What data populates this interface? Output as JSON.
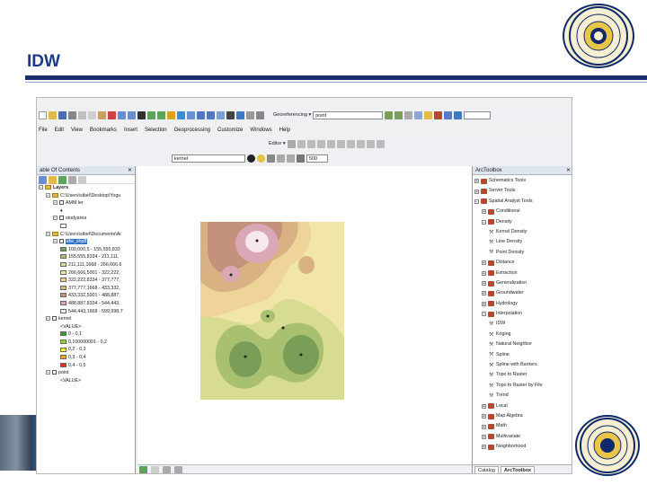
{
  "slide": {
    "title": "IDW"
  },
  "arcmap": {
    "menu": [
      "File",
      "Edit",
      "View",
      "Bookmarks",
      "Insert",
      "Selection",
      "Geoprocessing",
      "Customize",
      "Windows",
      "Help"
    ],
    "georef_label": "Georeferencing ▾",
    "georef_layer": "point",
    "editor_label": "Editor ▾",
    "layer_combo": "kernel",
    "resolution_combo": "500"
  },
  "toc": {
    "title": "able Of Contents",
    "rows": [
      {
        "indent": 0,
        "text": "Layers",
        "kind": "folder",
        "bold": true
      },
      {
        "indent": 1,
        "text": "C:\\Users\\sibel\\Desktop\\Yogu",
        "kind": "folder"
      },
      {
        "indent": 2,
        "text": "AMM ler",
        "kind": "check"
      },
      {
        "indent": 3,
        "text": "♦",
        "kind": "plain"
      },
      {
        "indent": 2,
        "text": "studyarea",
        "kind": "check"
      },
      {
        "indent": 3,
        "text": "",
        "kind": "swatch",
        "color": "#ffffff"
      },
      {
        "indent": 1,
        "text": "C:\\Users\\sibel\\Documents\\Ar",
        "kind": "folder"
      },
      {
        "indent": 2,
        "text": "idw_shp8",
        "kind": "check",
        "selected": true
      },
      {
        "indent": 3,
        "text": "100,000,5 - 155,555,833",
        "kind": "swatch",
        "color": "#7a9d58"
      },
      {
        "indent": 3,
        "text": "155,555,8334 - 211,111,",
        "kind": "swatch",
        "color": "#a8c06f"
      },
      {
        "indent": 3,
        "text": "211,111,1668 - 266,666,6",
        "kind": "swatch",
        "color": "#d8dc93"
      },
      {
        "indent": 3,
        "text": "266,666,5001 - 322,222,",
        "kind": "swatch",
        "color": "#f1e5a8"
      },
      {
        "indent": 3,
        "text": "322,222,8334 - 377,777,",
        "kind": "swatch",
        "color": "#efd49a"
      },
      {
        "indent": 3,
        "text": "377,777,1668 - 433,332,",
        "kind": "swatch",
        "color": "#d9b283"
      },
      {
        "indent": 3,
        "text": "433,332,5001 - 488,887,",
        "kind": "swatch",
        "color": "#c4917b"
      },
      {
        "indent": 3,
        "text": "488,887,8334 - 544,443,",
        "kind": "swatch",
        "color": "#d9a7b5"
      },
      {
        "indent": 3,
        "text": "544,443,1668 - 599,998,7",
        "kind": "swatch",
        "color": "#f7e7ee"
      },
      {
        "indent": 1,
        "text": "kernel",
        "kind": "check"
      },
      {
        "indent": 3,
        "text": "<VALUE>",
        "kind": "plain"
      },
      {
        "indent": 3,
        "text": "0 - 0,1",
        "kind": "swatch",
        "color": "#3a9b34"
      },
      {
        "indent": 3,
        "text": "0,100000001 - 0,2",
        "kind": "swatch",
        "color": "#9acd46"
      },
      {
        "indent": 3,
        "text": "0,2 - 0,3",
        "kind": "swatch",
        "color": "#f5f044"
      },
      {
        "indent": 3,
        "text": "0,3 - 0,4",
        "kind": "swatch",
        "color": "#f5a031"
      },
      {
        "indent": 3,
        "text": "0,4 - 0,5",
        "kind": "swatch",
        "color": "#e0301e"
      },
      {
        "indent": 1,
        "text": "point",
        "kind": "check"
      },
      {
        "indent": 3,
        "text": "<VALUE>",
        "kind": "plain"
      }
    ]
  },
  "toolbox": {
    "title": "ArcToolbox",
    "rows": [
      {
        "indent": 0,
        "text": "Schematics Tools",
        "kind": "toolbox",
        "exp": "+"
      },
      {
        "indent": 0,
        "text": "Server Tools",
        "kind": "toolbox",
        "exp": "+"
      },
      {
        "indent": 0,
        "text": "Spatial Analyst Tools",
        "kind": "toolbox",
        "exp": "-"
      },
      {
        "indent": 1,
        "text": "Conditional",
        "kind": "toolbox",
        "exp": "+"
      },
      {
        "indent": 1,
        "text": "Density",
        "kind": "toolbox",
        "exp": "-"
      },
      {
        "indent": 2,
        "text": "Kernel Density",
        "kind": "tool"
      },
      {
        "indent": 2,
        "text": "Line Density",
        "kind": "tool"
      },
      {
        "indent": 2,
        "text": "Point Density",
        "kind": "tool"
      },
      {
        "indent": 1,
        "text": "Distance",
        "kind": "toolbox",
        "exp": "+"
      },
      {
        "indent": 1,
        "text": "Extraction",
        "kind": "toolbox",
        "exp": "+"
      },
      {
        "indent": 1,
        "text": "Generalization",
        "kind": "toolbox",
        "exp": "+"
      },
      {
        "indent": 1,
        "text": "Groundwater",
        "kind": "toolbox",
        "exp": "+"
      },
      {
        "indent": 1,
        "text": "Hydrology",
        "kind": "toolbox",
        "exp": "+"
      },
      {
        "indent": 1,
        "text": "Interpolation",
        "kind": "toolbox",
        "exp": "-"
      },
      {
        "indent": 2,
        "text": "IDW",
        "kind": "tool"
      },
      {
        "indent": 2,
        "text": "Kriging",
        "kind": "tool"
      },
      {
        "indent": 2,
        "text": "Natural Neighbor",
        "kind": "tool"
      },
      {
        "indent": 2,
        "text": "Spline",
        "kind": "tool"
      },
      {
        "indent": 2,
        "text": "Spline with Barriers",
        "kind": "tool"
      },
      {
        "indent": 2,
        "text": "Topo to Raster",
        "kind": "tool"
      },
      {
        "indent": 2,
        "text": "Topo to Raster by File",
        "kind": "tool"
      },
      {
        "indent": 2,
        "text": "Trend",
        "kind": "tool"
      },
      {
        "indent": 1,
        "text": "Local",
        "kind": "toolbox",
        "exp": "+"
      },
      {
        "indent": 1,
        "text": "Map Algebra",
        "kind": "toolbox",
        "exp": "+"
      },
      {
        "indent": 1,
        "text": "Math",
        "kind": "toolbox",
        "exp": "+"
      },
      {
        "indent": 1,
        "text": "Multivariate",
        "kind": "toolbox",
        "exp": "+"
      },
      {
        "indent": 1,
        "text": "Neighborhood",
        "kind": "toolbox",
        "exp": "+"
      }
    ],
    "tabs": [
      "Catalog",
      "ArcToolbox"
    ]
  },
  "colors": {
    "title_blue": "#1b3a8c",
    "rule_navy": "#1b2e6e",
    "selection": "#3271c8"
  }
}
